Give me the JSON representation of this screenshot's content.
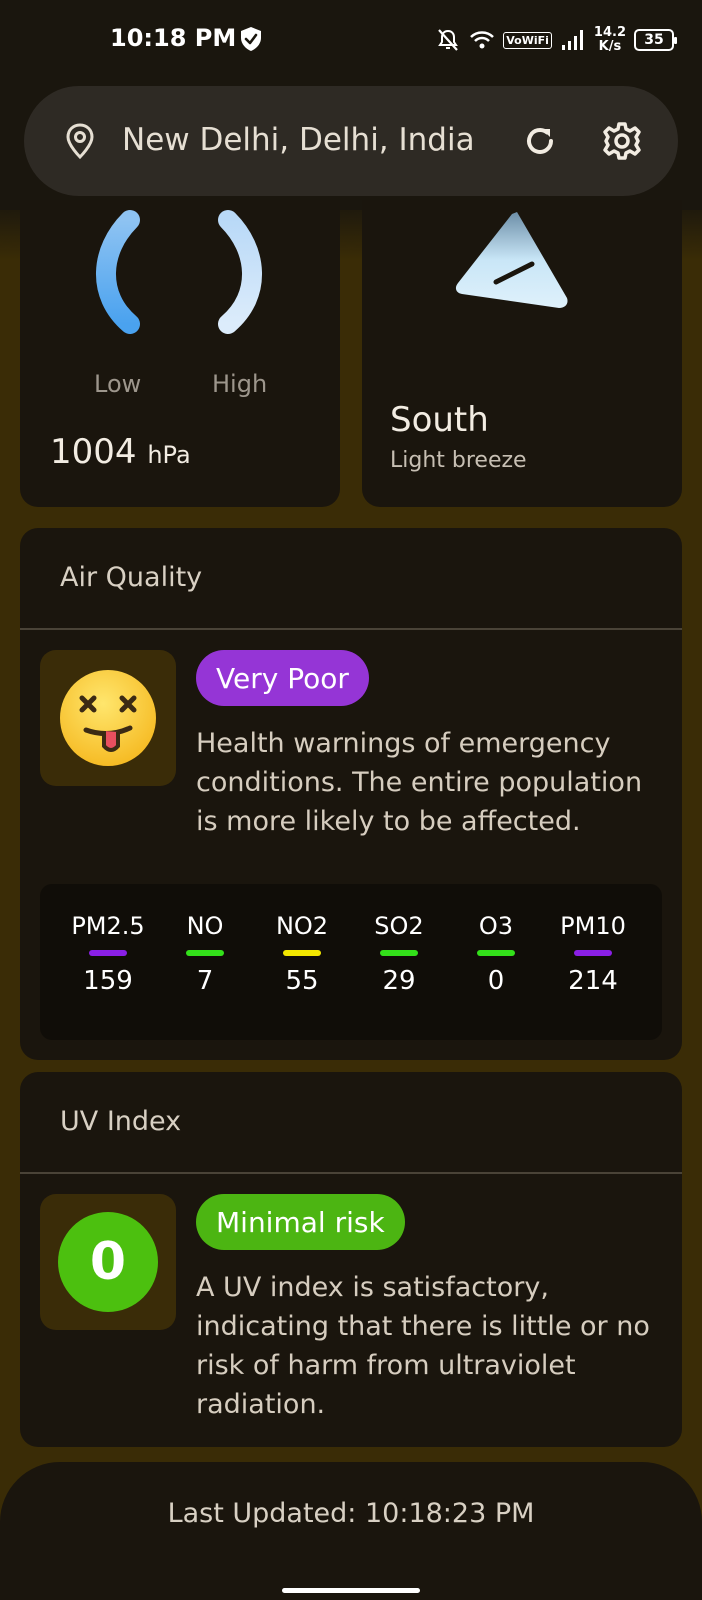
{
  "status_bar": {
    "time": "10:18 PM",
    "vowifi": "VoWiFi",
    "speed_value": "14.2",
    "speed_unit": "K/s",
    "battery": "35"
  },
  "search": {
    "location": "New Delhi, Delhi, India"
  },
  "pressure": {
    "low_label": "Low",
    "high_label": "High",
    "value": "1004",
    "unit": "hPa"
  },
  "wind": {
    "direction": "South",
    "description": "Light breeze"
  },
  "air_quality": {
    "title": "Air Quality",
    "status": "Very Poor",
    "status_color": "#9535d6",
    "description": "Health warnings of emergency conditions. The entire population is more likely to be affected.",
    "pollutants": [
      {
        "name": "PM2.5",
        "value": "159",
        "color": "#8a1fe6"
      },
      {
        "name": "NO",
        "value": "7",
        "color": "#33e01a"
      },
      {
        "name": "NO2",
        "value": "55",
        "color": "#f2e600"
      },
      {
        "name": "SO2",
        "value": "29",
        "color": "#33e01a"
      },
      {
        "name": "O3",
        "value": "0",
        "color": "#33e01a"
      },
      {
        "name": "PM10",
        "value": "214",
        "color": "#8a1fe6"
      }
    ]
  },
  "uv_index": {
    "title": "UV Index",
    "value": "0",
    "status": "Minimal risk",
    "status_color": "#4cb512",
    "description": "A UV index is satisfactory, indicating that there is little or no risk of harm from ultraviolet radiation."
  },
  "footer": {
    "last_updated": "Last Updated: 10:18:23 PM"
  }
}
